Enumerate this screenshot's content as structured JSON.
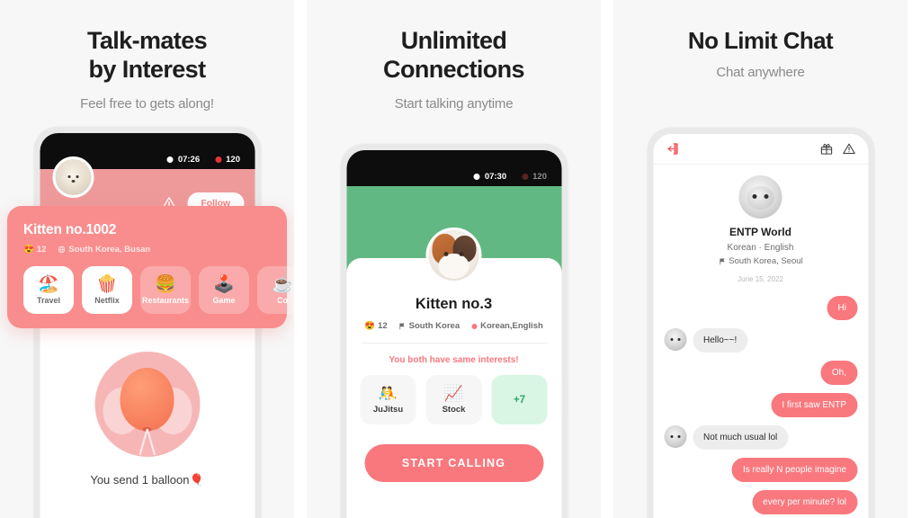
{
  "panels": [
    {
      "heading_line1": "Talk-mates",
      "heading_line2": "by Interest",
      "subheading": "Feel free to gets along!",
      "status": {
        "time": "07:26",
        "count": "120"
      },
      "actions": {
        "warning_icon": "warning-triangle-icon",
        "follow_label": "Follow"
      },
      "card": {
        "name": "Kitten no.1002",
        "age": "12",
        "age_emoji": "😍",
        "location": "South Korea, Busan",
        "location_icon": "globe-icon",
        "chips": [
          {
            "label": "Travel",
            "emoji": "🏖️",
            "style": "solid"
          },
          {
            "label": "Netflix",
            "emoji": "🍿",
            "style": "solid"
          },
          {
            "label": "Restaurants",
            "emoji": "🍔",
            "style": "ghost"
          },
          {
            "label": "Game",
            "emoji": "🕹️",
            "style": "ghost"
          },
          {
            "label": "Co",
            "emoji": "☕",
            "style": "ghost"
          }
        ]
      },
      "balloon": {
        "text": "You send 1 balloon",
        "emoji": "🎈"
      }
    },
    {
      "heading_line1": "Unlimited",
      "heading_line2": "Connections",
      "subheading": "Start talking anytime",
      "status": {
        "time": "07:30",
        "count": "120"
      },
      "profile": {
        "name": "Kitten no.3",
        "age": "12",
        "age_emoji": "😍",
        "country": "South Korea",
        "country_icon": "flag-icon",
        "languages": "Korean,English",
        "language_icon": "language-dot-icon"
      },
      "same_interests_note": "You both have same interests!",
      "interests": [
        {
          "label": "JuJitsu",
          "emoji": "🤼",
          "kind": "normal"
        },
        {
          "label": "Stock",
          "emoji": "📈",
          "kind": "normal"
        },
        {
          "label": "+7",
          "emoji": "",
          "kind": "more"
        }
      ],
      "cta_label": "START CALLING"
    },
    {
      "heading_line1": "No Limit Chat",
      "heading_line2": "",
      "subheading": "Chat anywhere",
      "header_icons": {
        "exit": "exit-door-icon",
        "gift": "gift-icon",
        "report": "warning-triangle-icon"
      },
      "profile": {
        "name": "ENTP World",
        "languages": "Korean · English",
        "location": "South Korea, Seoul",
        "location_icon": "flag-icon",
        "date": "June 15, 2022"
      },
      "messages": [
        {
          "from": "me",
          "text": "Hi"
        },
        {
          "from": "them",
          "text": "Hello~~!"
        },
        {
          "from": "me",
          "text": "Oh,"
        },
        {
          "from": "me",
          "text": "I first saw ENTP"
        },
        {
          "from": "them",
          "text": "Not much usual lol"
        },
        {
          "from": "me",
          "text": "Is really N people imagine"
        },
        {
          "from": "me",
          "text": "every per minute? lol"
        }
      ]
    }
  ],
  "colors": {
    "pink": "#f8787e",
    "card_pink": "#f98d8d",
    "hero_pink": "#ee9a9a",
    "green": "#62b883",
    "mint": "#d8f6e3",
    "panel_bg": "#f7f7f7"
  }
}
